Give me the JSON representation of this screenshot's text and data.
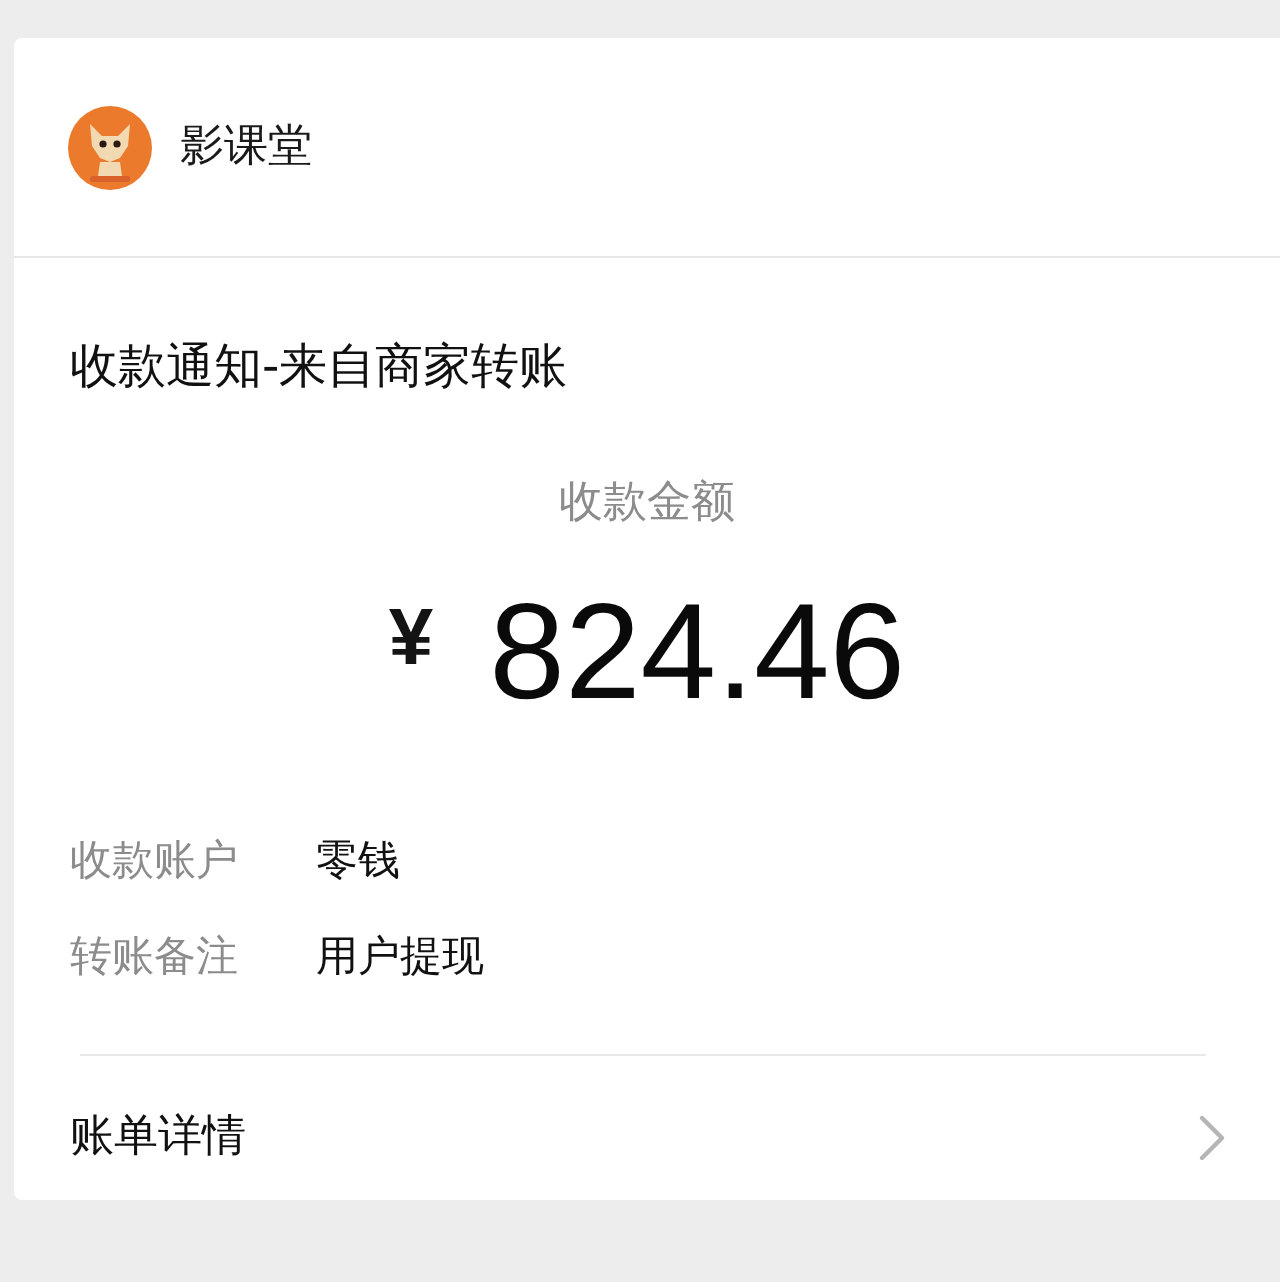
{
  "header": {
    "account_name": "影课堂"
  },
  "notice": {
    "title": "收款通知-来自商家转账",
    "amount_label": "收款金额",
    "currency": "¥",
    "amount": "824.46"
  },
  "details": [
    {
      "label": "收款账户",
      "value": "零钱"
    },
    {
      "label": "转账备注",
      "value": "用户提现"
    }
  ],
  "link": {
    "label": "账单详情"
  }
}
